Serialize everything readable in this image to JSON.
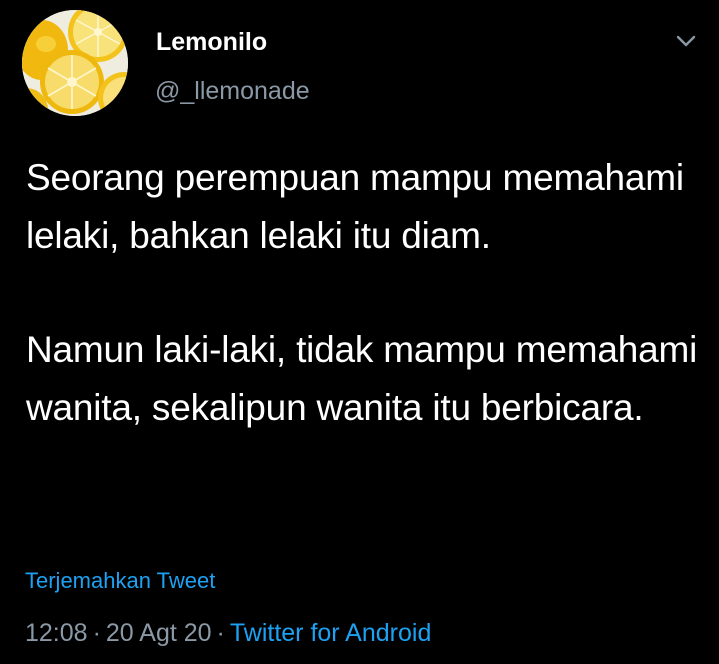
{
  "tweet": {
    "author": {
      "display_name": "Lemonilo",
      "handle": "@_llemonade",
      "avatar_icon": "lemon-slices-avatar-icon"
    },
    "menu_icon": "chevron-down-icon",
    "body": {
      "paragraph_1": "Seorang perempuan mampu memahami lelaki, bahkan lelaki itu diam.",
      "paragraph_2": "Namun laki-laki, tidak mampu memahami wanita, sekalipun wanita itu berbicara."
    },
    "translate_label": "Terjemahkan Tweet",
    "meta": {
      "time": "12:08",
      "separator": "·",
      "date": "20 Agt 20",
      "source": "Twitter for Android"
    }
  },
  "colors": {
    "background": "#000000",
    "text_primary": "#ffffff",
    "text_secondary": "#8b98a5",
    "link": "#1da1f2"
  }
}
